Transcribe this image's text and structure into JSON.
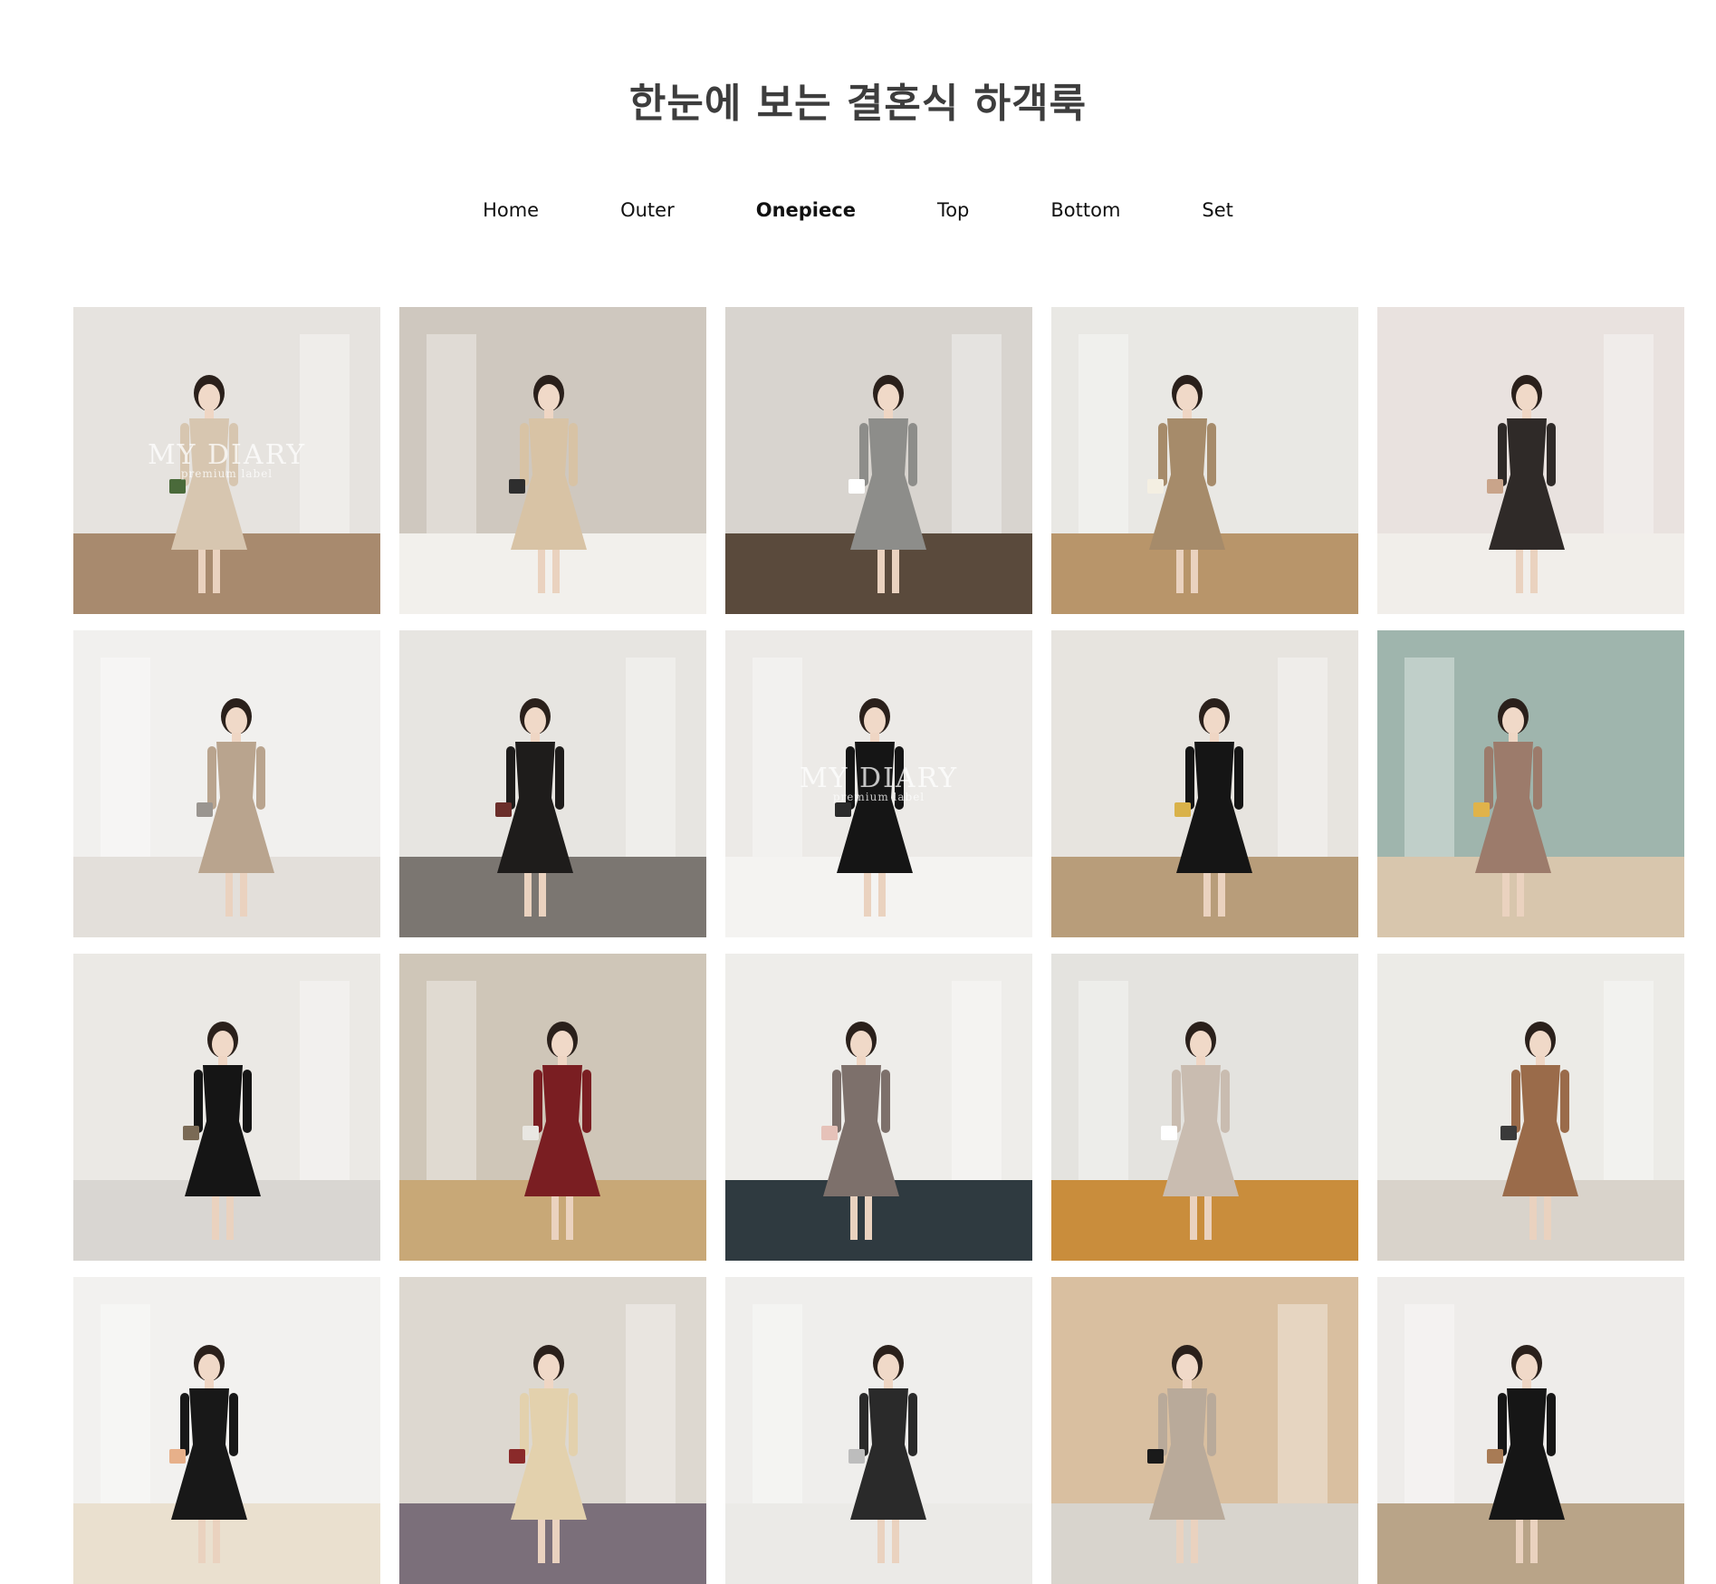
{
  "header": {
    "title": "한눈에 보는 결혼식 하객룩"
  },
  "nav": {
    "items": [
      {
        "label": "Home",
        "active": false
      },
      {
        "label": "Outer",
        "active": false
      },
      {
        "label": "Onepiece",
        "active": true
      },
      {
        "label": "Top",
        "active": false
      },
      {
        "label": "Bottom",
        "active": false
      },
      {
        "label": "Set",
        "active": false
      }
    ]
  },
  "gallery": {
    "watermark": "MY DIARY",
    "watermark_sub": "premium label",
    "tiles": [
      {
        "bg": "#e6e3df",
        "floor": "#a88a6e",
        "dress": "#d7c6b0",
        "accent": "#4a6a3a",
        "watermark": true
      },
      {
        "bg": "#cfc8bf",
        "floor": "#f2f0ec",
        "dress": "#d8c3a5",
        "accent": "#2e2e2e",
        "watermark": false
      },
      {
        "bg": "#d8d4cf",
        "floor": "#5a4a3c",
        "dress": "#8d8d8a",
        "accent": "#ffffff",
        "watermark": false
      },
      {
        "bg": "#e9e8e4",
        "floor": "#b8956a",
        "dress": "#a68b6a",
        "accent": "#f4efe2",
        "watermark": false
      },
      {
        "bg": "#e9e2df",
        "floor": "#f1eeea",
        "dress": "#2f2a28",
        "accent": "#c9a48a",
        "watermark": false
      },
      {
        "bg": "#f1f0ee",
        "floor": "#e3dfda",
        "dress": "#b9a48e",
        "accent": "#9a9590",
        "watermark": false
      },
      {
        "bg": "#e7e5e1",
        "floor": "#7b7671",
        "dress": "#1e1c1b",
        "accent": "#6b2e2a",
        "watermark": false
      },
      {
        "bg": "#eceae7",
        "floor": "#f4f3f1",
        "dress": "#151515",
        "accent": "#2b2b2b",
        "watermark": true
      },
      {
        "bg": "#e7e4df",
        "floor": "#b89d7a",
        "dress": "#151515",
        "accent": "#d9b24a",
        "watermark": false
      },
      {
        "bg": "#9fb5ad",
        "floor": "#d8c6ad",
        "dress": "#9c7b6b",
        "accent": "#e0b34a",
        "watermark": false
      },
      {
        "bg": "#ebe9e5",
        "floor": "#d9d6d2",
        "dress": "#151515",
        "accent": "#7a6a55",
        "watermark": false
      },
      {
        "bg": "#cfc6b8",
        "floor": "#c8a877",
        "dress": "#7a1e22",
        "accent": "#e9e7e2",
        "watermark": false
      },
      {
        "bg": "#eeedea",
        "floor": "#2f3a40",
        "dress": "#7d706b",
        "accent": "#e6c2b9",
        "watermark": false
      },
      {
        "bg": "#e4e3df",
        "floor": "#c98d3c",
        "dress": "#c9bcb0",
        "accent": "#ffffff",
        "watermark": false
      },
      {
        "bg": "#ecebe7",
        "floor": "#d9d3cb",
        "dress": "#9a6b4a",
        "accent": "#3a3a3a",
        "watermark": false
      },
      {
        "bg": "#f2f1ef",
        "floor": "#eae0cf",
        "dress": "#181818",
        "accent": "#e7b08a",
        "watermark": false
      },
      {
        "bg": "#ddd8d0",
        "floor": "#7b6f7a",
        "dress": "#e3d1ad",
        "accent": "#8a2a2a",
        "watermark": false
      },
      {
        "bg": "#efeeec",
        "floor": "#ebeae7",
        "dress": "#2a2a2a",
        "accent": "#bdbdbd",
        "watermark": false
      },
      {
        "bg": "#d9bfa0",
        "floor": "#d8d4cd",
        "dress": "#b9aa9a",
        "accent": "#1a1a1a",
        "watermark": false
      },
      {
        "bg": "#eeecea",
        "floor": "#b9a488",
        "dress": "#161616",
        "accent": "#a87b55",
        "watermark": false
      }
    ]
  }
}
